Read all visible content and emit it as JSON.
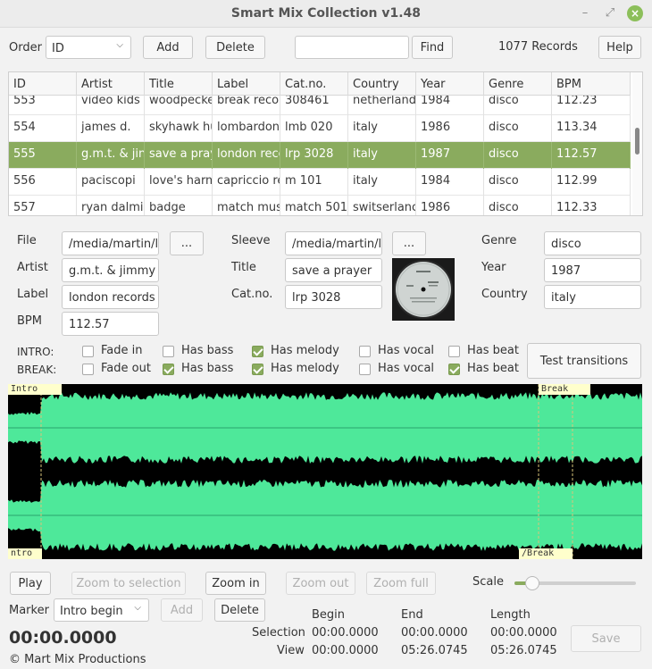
{
  "window": {
    "title": "Smart Mix Collection v1.48"
  },
  "toolbar": {
    "order_label": "Order",
    "order_value": "ID",
    "add_label": "Add",
    "delete_label": "Delete",
    "search_value": "",
    "find_label": "Find",
    "records": "1077 Records",
    "help_label": "Help"
  },
  "table": {
    "columns": [
      "ID",
      "Artist",
      "Title",
      "Label",
      "Cat.no.",
      "Country",
      "Year",
      "Genre",
      "BPM"
    ],
    "rows": [
      [
        "553",
        "video kids",
        "woodpecke",
        "break reco",
        "308461",
        "netherland",
        "1984",
        "disco",
        "112.23"
      ],
      [
        "554",
        "james d.",
        "skyhawk hu",
        "lombardon",
        "lmb 020",
        "italy",
        "1986",
        "disco",
        "113.34"
      ],
      [
        "555",
        "g.m.t. & jin",
        "save a pray",
        "london reco",
        "lrp 3028",
        "italy",
        "1987",
        "disco",
        "112.57"
      ],
      [
        "556",
        "paciscopi",
        "love's harm",
        "capriccio re",
        "m 101",
        "italy",
        "1984",
        "disco",
        "112.99"
      ],
      [
        "557",
        "ryan dalmir",
        "badge",
        "match mus",
        "match 5018",
        "switserlanc",
        "1986",
        "disco",
        "112.33"
      ]
    ],
    "selected_index": 2
  },
  "details": {
    "file_label": "File",
    "file_value": "/media/martin/l",
    "browse_label": "...",
    "artist_label": "Artist",
    "artist_value": "g.m.t. & jimmy",
    "label_label": "Label",
    "label_value": "london records",
    "bpm_label": "BPM",
    "bpm_value": "112.57",
    "sleeve_label": "Sleeve",
    "sleeve_value": "/media/martin/l",
    "title_label": "Title",
    "title_value": "save a prayer",
    "catno_label": "Cat.no.",
    "catno_value": "lrp 3028",
    "genre_label": "Genre",
    "genre_value": "disco",
    "year_label": "Year",
    "year_value": "1987",
    "country_label": "Country",
    "country_value": "italy"
  },
  "flags": {
    "intro_label": "INTRO:",
    "break_label": "BREAK:",
    "options": [
      "Fade in",
      "Has bass",
      "Has melody",
      "Has vocal",
      "Has beat"
    ],
    "break_options": [
      "Fade out",
      "Has bass",
      "Has melody",
      "Has vocal",
      "Has beat"
    ],
    "intro_checked": [
      false,
      false,
      true,
      false,
      false
    ],
    "break_checked": [
      false,
      true,
      true,
      false,
      true
    ],
    "test_label": "Test transitions"
  },
  "waveform": {
    "tag_intro": "Intro",
    "tag_break": "Break",
    "tag_intro_end": "ntro",
    "tag_break_end": "/Break",
    "wave_color": "#4ee89a"
  },
  "controls": {
    "play_label": "Play",
    "zoom_sel_label": "Zoom to selection",
    "zoom_in_label": "Zoom in",
    "zoom_out_label": "Zoom out",
    "zoom_full_label": "Zoom full",
    "scale_label": "Scale",
    "scale_fraction": 0.15,
    "marker_label": "Marker",
    "marker_value": "Intro begin",
    "marker_add_label": "Add",
    "marker_delete_label": "Delete",
    "time_display": "00:00.0000",
    "begin_header": "Begin",
    "end_header": "End",
    "length_header": "Length",
    "selection_label": "Selection",
    "view_label": "View",
    "sel_begin": "00:00.0000",
    "sel_end": "00:00.0000",
    "sel_length": "00:00.0000",
    "view_begin": "00:00.0000",
    "view_end": "05:26.0745",
    "view_length": "05:26.0745",
    "save_label": "Save",
    "copyright": "© Mart Mix Productions"
  },
  "accent": "#8aab5e"
}
